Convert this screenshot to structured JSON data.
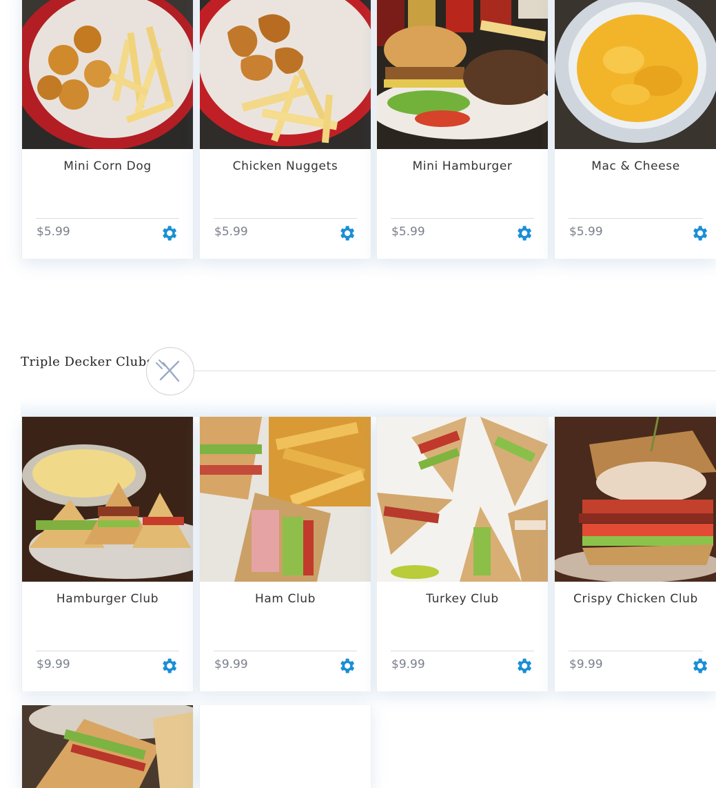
{
  "accent_color": "#1a8fd6",
  "top_section": {
    "items": [
      {
        "name": "Mini Corn Dog",
        "price": "$5.99",
        "image": "corn-dog-photo"
      },
      {
        "name": "Chicken Nuggets",
        "price": "$5.99",
        "image": "chicken-nuggets-photo"
      },
      {
        "name": "Mini Hamburger",
        "price": "$5.99",
        "image": "hamburger-photo"
      },
      {
        "name": "Mac & Cheese",
        "price": "$5.99",
        "image": "mac-cheese-photo"
      }
    ]
  },
  "clubs_section": {
    "title": "Triple Decker Clubs",
    "emblem_icon": "fork-knife-icon",
    "items": [
      {
        "name": "Hamburger Club",
        "price": "$9.99",
        "image": "hamburger-club-photo"
      },
      {
        "name": "Ham Club",
        "price": "$9.99",
        "image": "ham-club-photo"
      },
      {
        "name": "Turkey Club",
        "price": "$9.99",
        "image": "turkey-club-photo"
      },
      {
        "name": "Crispy Chicken Club",
        "price": "$9.99",
        "image": "crispy-chicken-club-photo"
      }
    ]
  },
  "options_icon": "gear-icon"
}
